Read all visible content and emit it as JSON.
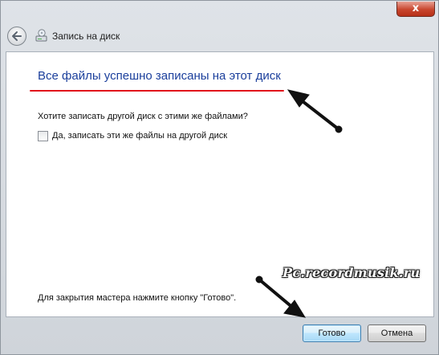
{
  "window": {
    "title": "Запись на диск",
    "close_symbol": "x"
  },
  "main": {
    "heading": "Все файлы успешно записаны на этот диск",
    "question": "Хотите записать другой диск с этими же файлами?",
    "checkbox_label": "Да, записать эти же файлы на другой диск",
    "checkbox_checked": false,
    "closing_text": "Для закрытия мастера нажмите кнопку \"Готово\"."
  },
  "buttons": {
    "done_label": "Готово",
    "cancel_label": "Отмена"
  },
  "watermark": "Pc.recordmusik.ru",
  "icons": {
    "back": "back-arrow-icon",
    "title": "disc-burner-icon",
    "close": "close-icon"
  },
  "colors": {
    "heading": "#1b3f9c",
    "underline_annotation": "#e2141b",
    "annotation_arrows": "#111111"
  }
}
